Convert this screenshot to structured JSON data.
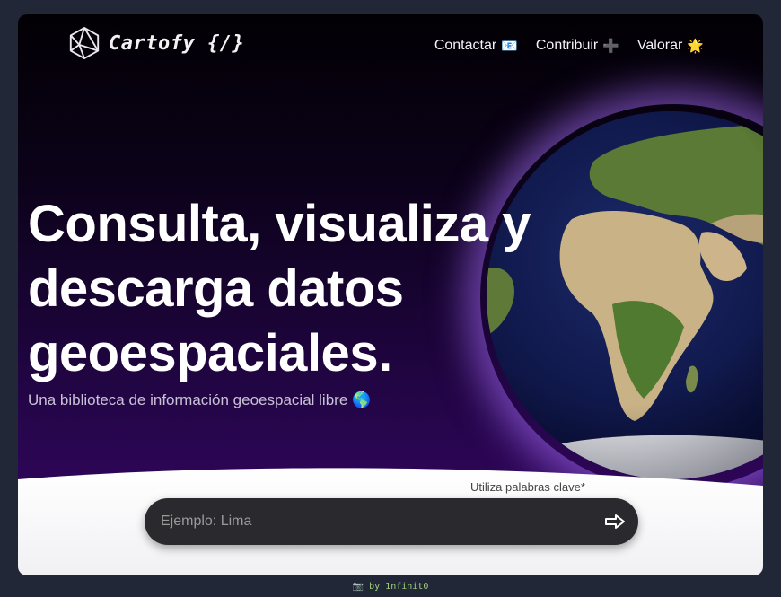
{
  "brand": {
    "name": "Cartofy {/}",
    "logo_icon": "polyhedron-icon"
  },
  "nav": [
    {
      "label": "Contactar",
      "emoji": "📧",
      "icon": "email-icon"
    },
    {
      "label": "Contribuir",
      "emoji": "➕",
      "icon": "plus-icon"
    },
    {
      "label": "Valorar",
      "emoji": "🌟",
      "icon": "star-icon"
    }
  ],
  "hero": {
    "headline_line1": "Consulta, visualiza y",
    "headline_line2": "descarga datos",
    "headline_line3": "geoespaciales.",
    "subtitle": "Una biblioteca de información geoespacial libre 🌎"
  },
  "search": {
    "hint": "Utiliza palabras clave*",
    "placeholder": "Ejemplo: Lima",
    "value": "",
    "submit_icon": "arrow-right-icon"
  },
  "footer": {
    "text": "📷 by 1nfinit0"
  },
  "colors": {
    "page_bg": "#222738",
    "hero_dark": "#020004",
    "hero_purple": "#36085e",
    "search_bg": "#2a2a2e",
    "glow": "#aa6eff"
  }
}
